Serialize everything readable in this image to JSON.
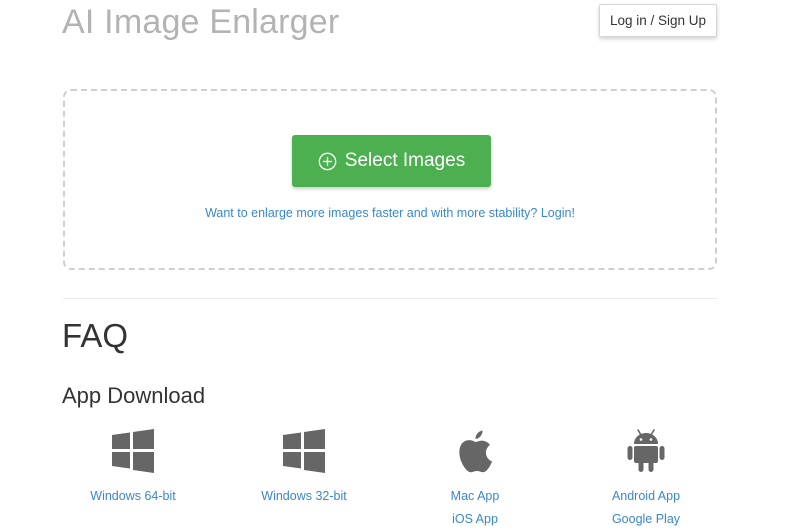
{
  "header": {
    "title": "AI Image Enlarger",
    "login_label": "Log in / Sign Up"
  },
  "upload": {
    "select_label": "Select Images",
    "login_prompt": "Want to enlarge more images faster and with more stability? Login!"
  },
  "faq": {
    "heading": "FAQ"
  },
  "app_download": {
    "heading": "App Download",
    "items": [
      {
        "icon": "windows-icon",
        "links": [
          "Windows 64-bit"
        ]
      },
      {
        "icon": "windows-icon",
        "links": [
          "Windows 32-bit"
        ]
      },
      {
        "icon": "apple-icon",
        "links": [
          "Mac App",
          "iOS App"
        ]
      },
      {
        "icon": "android-icon",
        "links": [
          "Android App",
          "Google Play"
        ]
      }
    ]
  },
  "colors": {
    "accent_green": "#4cb050",
    "link_blue": "#3a88c8",
    "icon_gray": "#666666",
    "title_gray": "#b3b3b3"
  }
}
